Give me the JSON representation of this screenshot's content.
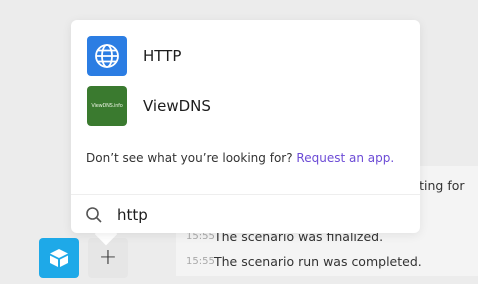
{
  "popover": {
    "results": [
      {
        "label": "HTTP",
        "icon": "globe-icon",
        "color": "#2b7de3"
      },
      {
        "label": "ViewDNS",
        "icon": "viewdns-logo",
        "logo_text": "ViewDNS.info",
        "color": "#3a7a2f"
      }
    ],
    "hint_text": "Don’t see what you’re looking for?",
    "hint_link": "Request an app.",
    "search": {
      "value": "http",
      "icon": "search-icon"
    }
  },
  "log": {
    "partial_text": "aiting for",
    "entries": [
      {
        "time": "15:55",
        "text": "The scenario was finalized."
      },
      {
        "time": "15:55",
        "text": "The scenario run was completed."
      }
    ]
  },
  "toolbar": {
    "app_logo": "app-logo-icon",
    "add_label": "+"
  },
  "colors": {
    "accent_link": "#6c4bd6",
    "app_logo": "#1ea9e8"
  }
}
